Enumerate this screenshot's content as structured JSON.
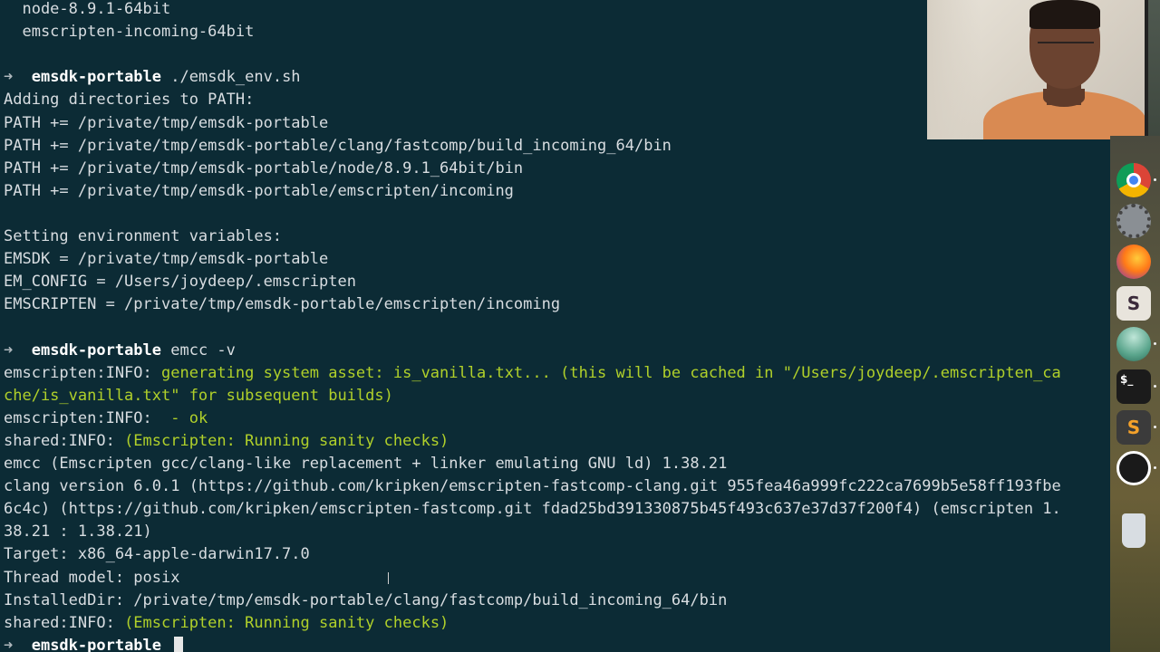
{
  "terminal": {
    "prompt_arrow": "➜",
    "prompt_dir": "emsdk-portable",
    "lines": [
      {
        "kind": "plain",
        "text": "  node-8.9.1-64bit"
      },
      {
        "kind": "plain",
        "text": "  emscripten-incoming-64bit"
      },
      {
        "kind": "blank",
        "text": ""
      },
      {
        "kind": "prompt",
        "command": " ./emsdk_env.sh"
      },
      {
        "kind": "plain",
        "text": "Adding directories to PATH:"
      },
      {
        "kind": "plain",
        "text": "PATH += /private/tmp/emsdk-portable"
      },
      {
        "kind": "plain",
        "text": "PATH += /private/tmp/emsdk-portable/clang/fastcomp/build_incoming_64/bin"
      },
      {
        "kind": "plain",
        "text": "PATH += /private/tmp/emsdk-portable/node/8.9.1_64bit/bin"
      },
      {
        "kind": "plain",
        "text": "PATH += /private/tmp/emsdk-portable/emscripten/incoming"
      },
      {
        "kind": "blank",
        "text": ""
      },
      {
        "kind": "plain",
        "text": "Setting environment variables:"
      },
      {
        "kind": "plain",
        "text": "EMSDK = /private/tmp/emsdk-portable"
      },
      {
        "kind": "plain",
        "text": "EM_CONFIG = /Users/joydeep/.emscripten"
      },
      {
        "kind": "plain",
        "text": "EMSCRIPTEN = /private/tmp/emsdk-portable/emscripten/incoming"
      },
      {
        "kind": "blank",
        "text": ""
      },
      {
        "kind": "prompt",
        "command": " emcc -v"
      },
      {
        "kind": "info",
        "prefix": "emscripten:INFO: ",
        "text": "generating system asset: is_vanilla.txt... (this will be cached in \"/Users/joydeep/.emscripten_ca"
      },
      {
        "kind": "info",
        "prefix": "",
        "text": "che/is_vanilla.txt\" for subsequent builds)"
      },
      {
        "kind": "info",
        "prefix": "emscripten:INFO: ",
        "text": " - ok"
      },
      {
        "kind": "info",
        "prefix": "shared:INFO: ",
        "text": "(Emscripten: Running sanity checks)"
      },
      {
        "kind": "plain",
        "text": "emcc (Emscripten gcc/clang-like replacement + linker emulating GNU ld) 1.38.21"
      },
      {
        "kind": "plain",
        "text": "clang version 6.0.1 (https://github.com/kripken/emscripten-fastcomp-clang.git 955fea46a999fc222ca7699b5e58ff193fbe"
      },
      {
        "kind": "plain",
        "text": "6c4c) (https://github.com/kripken/emscripten-fastcomp.git fdad25bd391330875b45f493c637e37d37f200f4) (emscripten 1."
      },
      {
        "kind": "plain",
        "text": "38.21 : 1.38.21)"
      },
      {
        "kind": "plain",
        "text": "Target: x86_64-apple-darwin17.7.0"
      },
      {
        "kind": "plain",
        "text": "Thread model: posix"
      },
      {
        "kind": "plain",
        "text": "InstalledDir: /private/tmp/emsdk-portable/clang/fastcomp/build_incoming_64/bin"
      },
      {
        "kind": "info",
        "prefix": "shared:INFO: ",
        "text": "(Emscripten: Running sanity checks)"
      },
      {
        "kind": "prompt",
        "command": " ",
        "cursor": true
      }
    ]
  },
  "dock": {
    "items": [
      {
        "name": "chrome-icon",
        "label": "",
        "color": "#db4437"
      },
      {
        "name": "system-preferences-icon",
        "label": "",
        "color": "#8a8f94"
      },
      {
        "name": "firefox-icon",
        "label": "",
        "color": "#ff7a18"
      },
      {
        "name": "slack-icon",
        "label": "S",
        "color": "#e8e4dc"
      },
      {
        "name": "app-landscape-icon",
        "label": "",
        "color": "#5aa58c"
      },
      {
        "name": "terminal-icon",
        "label": "$_",
        "color": "#1b1b1b"
      },
      {
        "name": "sublime-text-icon",
        "label": "S",
        "color": "#3b3b3b"
      },
      {
        "name": "obs-icon",
        "label": "",
        "color": "#1a1a1a"
      },
      {
        "name": "trash-icon",
        "label": "",
        "color": "#d8dde2"
      }
    ]
  }
}
